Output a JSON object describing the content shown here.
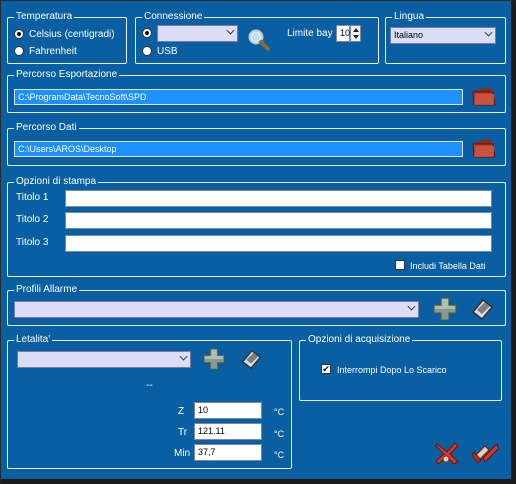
{
  "temperatura": {
    "title": "Temperatura",
    "celsius": "Celsius (centigradi)",
    "fahrenheit": "Fahrenheit"
  },
  "connessione": {
    "title": "Connessione",
    "usb": "USB",
    "limite_label": "Limite bay",
    "limite_value": "10"
  },
  "lingua": {
    "title": "Lingua",
    "selected": "Italiano"
  },
  "esportazione": {
    "title": "Percorso Esportazione",
    "path": "C:\\ProgramData\\TecnoSoft\\SPD"
  },
  "dati": {
    "title": "Percorso Dati",
    "path": "C:\\Users\\AROS\\Desktop"
  },
  "stampa": {
    "title": "Opzioni di stampa",
    "titolo1": "Titolo 1",
    "titolo2": "Titolo 2",
    "titolo3": "Titolo 3",
    "includi": "Includi Tabella Dati"
  },
  "allarme": {
    "title": "Profili Allarme"
  },
  "letalita": {
    "title": "Letalita'",
    "dash": "--",
    "z_label": "Z",
    "z_value": "10",
    "tr_label": "Tr",
    "tr_value": "121.11",
    "min_label": "Min",
    "min_value": "37,7",
    "unit": "°C"
  },
  "acquisizione": {
    "title": "Opzioni di acquisizione",
    "interrompi": "Interrompi Dopo Lo Scarico"
  },
  "colors": {
    "background": "#0a5fa3",
    "path_fill": "#1e90ff",
    "combo_fill": "#dcdcf7"
  }
}
